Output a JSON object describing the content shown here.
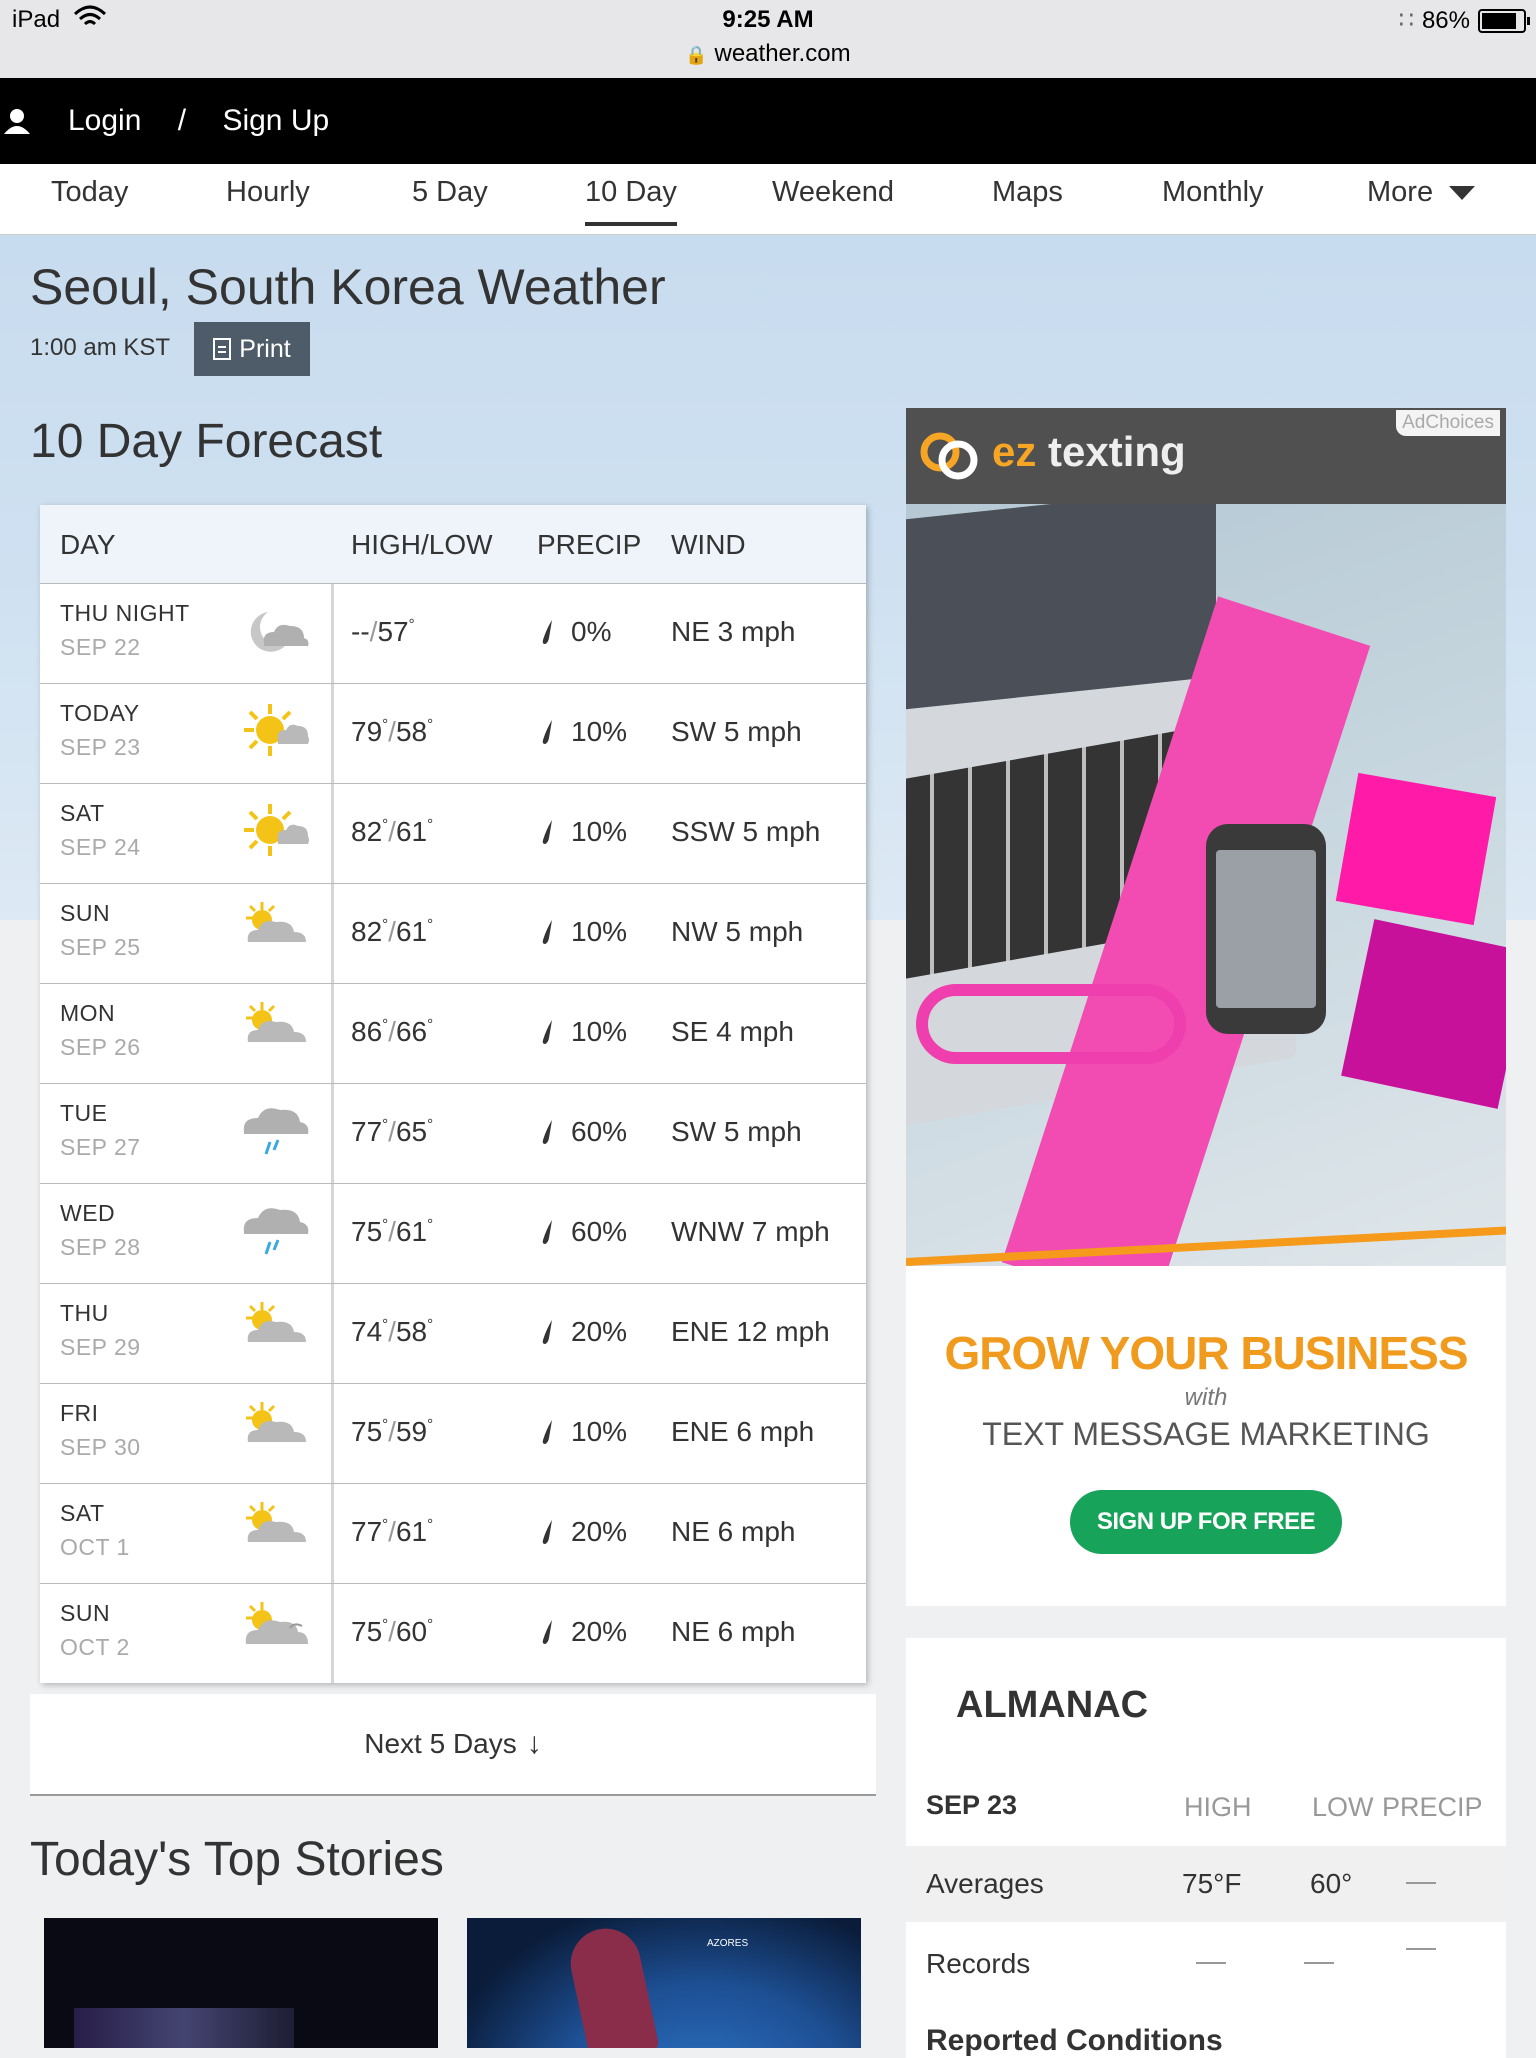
{
  "status_bar": {
    "device": "iPad",
    "time": "9:25 AM",
    "url": "weather.com",
    "battery": "86%"
  },
  "login_bar": {
    "login": "Login",
    "separator": "/",
    "signup": "Sign Up"
  },
  "nav": {
    "items": [
      "Today",
      "Hourly",
      "5 Day",
      "10 Day",
      "Weekend",
      "Maps",
      "Monthly",
      "More"
    ],
    "active": "10 Day"
  },
  "location": {
    "title": "Seoul, South Korea Weather",
    "time": "1:00 am KST",
    "print_label": "Print"
  },
  "forecast": {
    "title": "10 Day Forecast",
    "headers": {
      "day": "DAY",
      "hilo": "HIGH/LOW",
      "precip": "PRECIP",
      "wind": "WIND"
    },
    "rows": [
      {
        "day": "THU NIGHT",
        "date": "SEP 22",
        "icon": "night-cloudy-icon",
        "high": "--",
        "low": "57",
        "precip": "0%",
        "wind": "NE 3 mph"
      },
      {
        "day": "TODAY",
        "date": "SEP 23",
        "icon": "sun-cloud-icon",
        "high": "79",
        "low": "58",
        "precip": "10%",
        "wind": "SW 5 mph"
      },
      {
        "day": "SAT",
        "date": "SEP 24",
        "icon": "sun-cloud-icon",
        "high": "82",
        "low": "61",
        "precip": "10%",
        "wind": "SSW 5 mph"
      },
      {
        "day": "SUN",
        "date": "SEP 25",
        "icon": "partly-cloudy-icon",
        "high": "82",
        "low": "61",
        "precip": "10%",
        "wind": "NW 5 mph"
      },
      {
        "day": "MON",
        "date": "SEP 26",
        "icon": "partly-cloudy-icon",
        "high": "86",
        "low": "66",
        "precip": "10%",
        "wind": "SE 4 mph"
      },
      {
        "day": "TUE",
        "date": "SEP 27",
        "icon": "rain-icon",
        "high": "77",
        "low": "65",
        "precip": "60%",
        "wind": "SW 5 mph"
      },
      {
        "day": "WED",
        "date": "SEP 28",
        "icon": "rain-icon",
        "high": "75",
        "low": "61",
        "precip": "60%",
        "wind": "WNW 7 mph"
      },
      {
        "day": "THU",
        "date": "SEP 29",
        "icon": "partly-cloudy-icon",
        "high": "74",
        "low": "58",
        "precip": "20%",
        "wind": "ENE 12 mph"
      },
      {
        "day": "FRI",
        "date": "SEP 30",
        "icon": "partly-cloudy-icon",
        "high": "75",
        "low": "59",
        "precip": "10%",
        "wind": "ENE 6 mph"
      },
      {
        "day": "SAT",
        "date": "OCT 1",
        "icon": "partly-cloudy-icon",
        "high": "77",
        "low": "61",
        "precip": "20%",
        "wind": "NE 6 mph"
      },
      {
        "day": "SUN",
        "date": "OCT 2",
        "icon": "mostly-cloudy-icon",
        "high": "75",
        "low": "60",
        "precip": "20%",
        "wind": "NE 6 mph"
      }
    ],
    "next_label": "Next 5 Days"
  },
  "stories": {
    "title": "Today's Top Stories",
    "map_label": "AZORES"
  },
  "ad": {
    "adchoices": "AdChoices",
    "brand_ez": "ez",
    "brand_texting": "texting",
    "headline": "GROW YOUR BUSINESS",
    "with": "with",
    "subhead": "TEXT MESSAGE MARKETING",
    "cta": "SIGN UP FOR FREE"
  },
  "almanac": {
    "title": "ALMANAC",
    "date": "SEP 23",
    "col_high": "HIGH",
    "col_low": "LOW",
    "col_precip": "PRECIP",
    "averages_label": "Averages",
    "avg_high": "75°F",
    "avg_low": "60°",
    "records_label": "Records",
    "reported": "Reported Conditions"
  },
  "colors": {
    "accent_orange": "#f09a1e",
    "cta_green": "#18a35a",
    "print_btn": "#4e5c6a"
  }
}
